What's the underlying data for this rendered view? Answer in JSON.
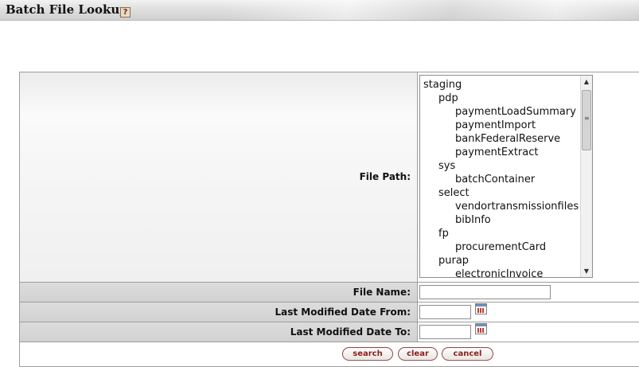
{
  "header": {
    "title": "Batch File Lookup",
    "help_icon": "help-icon"
  },
  "form": {
    "file_path_label": "File Path:",
    "file_name_label": "File Name:",
    "date_from_label": "Last Modified Date From:",
    "date_to_label": "Last Modified Date To:",
    "file_name_value": "",
    "date_from_value": "",
    "date_to_value": "",
    "calendar_icon": "calendar-icon"
  },
  "tree": {
    "nodes": [
      {
        "label": "staging",
        "level": 0
      },
      {
        "label": "pdp",
        "level": 1
      },
      {
        "label": "paymentLoadSummary",
        "level": 2
      },
      {
        "label": "paymentImport",
        "level": 2
      },
      {
        "label": "bankFederalReserve",
        "level": 2
      },
      {
        "label": "paymentExtract",
        "level": 2
      },
      {
        "label": "sys",
        "level": 1
      },
      {
        "label": "batchContainer",
        "level": 2
      },
      {
        "label": "select",
        "level": 1
      },
      {
        "label": "vendortransmissionfiles",
        "level": 2
      },
      {
        "label": "bibInfo",
        "level": 2
      },
      {
        "label": "fp",
        "level": 1
      },
      {
        "label": "procurementCard",
        "level": 2
      },
      {
        "label": "purap",
        "level": 1
      },
      {
        "label": "electronicInvoice",
        "level": 2
      }
    ]
  },
  "buttons": {
    "search": "search",
    "clear": "clear",
    "cancel": "cancel"
  }
}
